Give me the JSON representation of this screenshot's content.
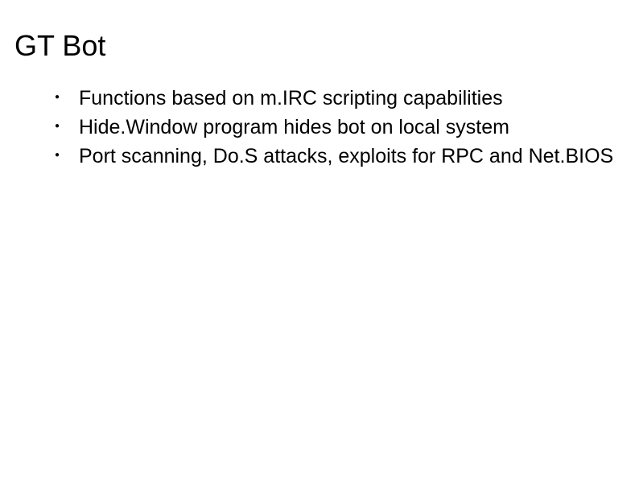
{
  "slide": {
    "title": "GT Bot",
    "bullets": [
      "Functions based on m.IRC scripting capabilities",
      "Hide.Window program hides bot on local system",
      "Port scanning, Do.S attacks, exploits for RPC and Net.BIOS"
    ]
  }
}
